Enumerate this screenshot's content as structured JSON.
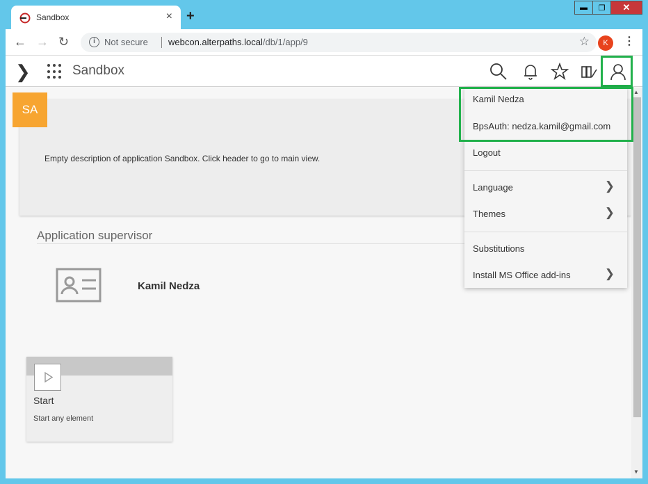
{
  "browser": {
    "tab_title": "Sandbox",
    "tab_close": "×",
    "new_tab": "+",
    "security_label": "Not secure",
    "url_host": "webcon.alterpaths.local",
    "url_path": "/db/1/app/9",
    "profile_initial": "K",
    "window_controls": {
      "minimize": "▬",
      "maximize": "❐",
      "close": "✕"
    }
  },
  "app": {
    "title": "Sandbox",
    "badge": "SA",
    "description": "Empty description of application Sandbox. Click header to go to main view.",
    "supervisor_heading": "Application supervisor",
    "supervisor_name": "Kamil Nedza",
    "start_tile": {
      "title": "Start",
      "subtitle": "Start any element"
    }
  },
  "user_menu": {
    "user_name": "Kamil Nedza",
    "auth_info": "BpsAuth: nedza.kamil@gmail.com",
    "logout": "Logout",
    "language": "Language",
    "themes": "Themes",
    "substitutions": "Substitutions",
    "install_office": "Install MS Office add-ins"
  },
  "colors": {
    "highlight": "#22b14c",
    "badge": "#f7a531",
    "titlebar": "#63c7ea",
    "profile": "#e8431d"
  }
}
